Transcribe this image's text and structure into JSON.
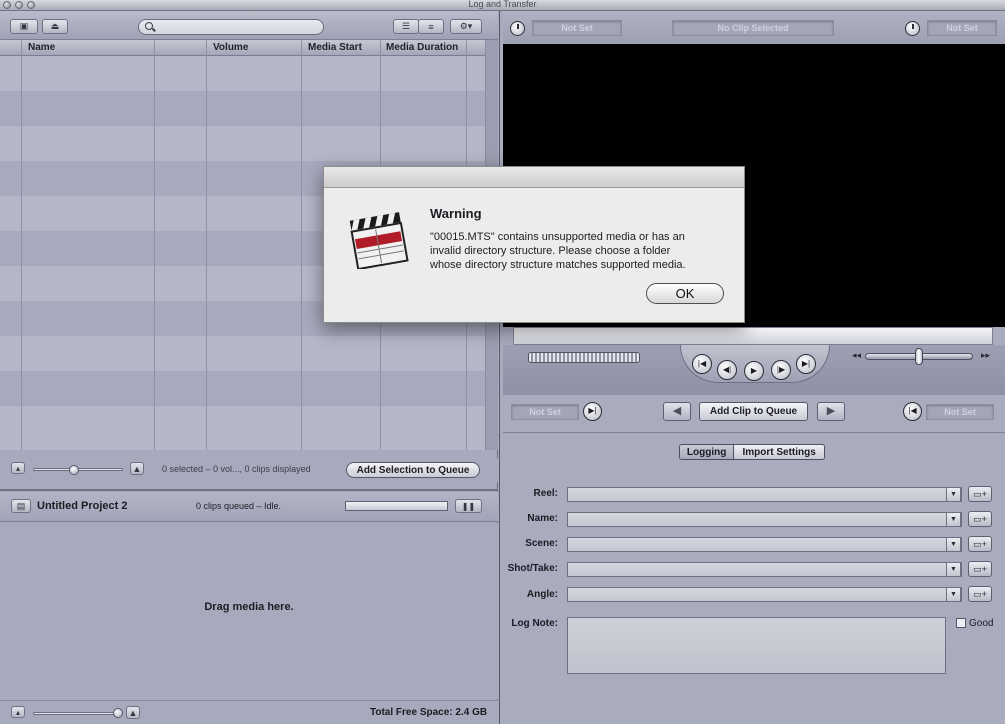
{
  "window": {
    "title": "Log and Transfer"
  },
  "browser": {
    "search_placeholder": "",
    "columns": [
      "Name",
      "Volume",
      "Media Start",
      "Media Duration"
    ],
    "status_text": "0 selected – 0 vol..., 0 clips displayed",
    "add_selection_label": "Add Selection to Queue"
  },
  "project": {
    "name": "Untitled Project 2",
    "queue_status": "0 clips queued – Idle.",
    "pause_symbol": "❚❚",
    "drop_text": "Drag media here.",
    "free_space": "Total Free Space: 2.4 GB"
  },
  "viewer": {
    "in_point": "Not Set",
    "clip_name": "No Clip Selected",
    "out_point": "Not Set",
    "mark_in": "Not Set",
    "mark_out": "Not Set",
    "add_clip_label": "Add Clip to Queue"
  },
  "logging": {
    "tabs": [
      {
        "label": "Logging",
        "selected": true
      },
      {
        "label": "Import Settings",
        "selected": false
      }
    ],
    "fields": [
      {
        "label": "Reel:",
        "value": ""
      },
      {
        "label": "Name:",
        "value": ""
      },
      {
        "label": "Scene:",
        "value": ""
      },
      {
        "label": "Shot/Take:",
        "value": ""
      },
      {
        "label": "Angle:",
        "value": ""
      }
    ],
    "log_note_label": "Log Note:",
    "good_label": "Good",
    "good_checked": false
  },
  "dialog": {
    "title": "Warning",
    "message_lines": [
      "\"00015.MTS\" contains unsupported media or has an",
      "invalid directory structure. Please choose a folder",
      "whose directory structure matches supported media."
    ],
    "ok_label": "OK"
  }
}
